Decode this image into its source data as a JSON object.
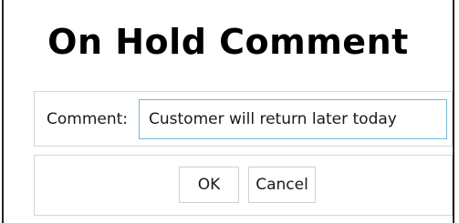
{
  "dialog": {
    "title": "On Hold Comment"
  },
  "comment": {
    "label": "Comment:",
    "value": "Customer will return later today"
  },
  "buttons": {
    "ok_label": "OK",
    "cancel_label": "Cancel"
  }
}
